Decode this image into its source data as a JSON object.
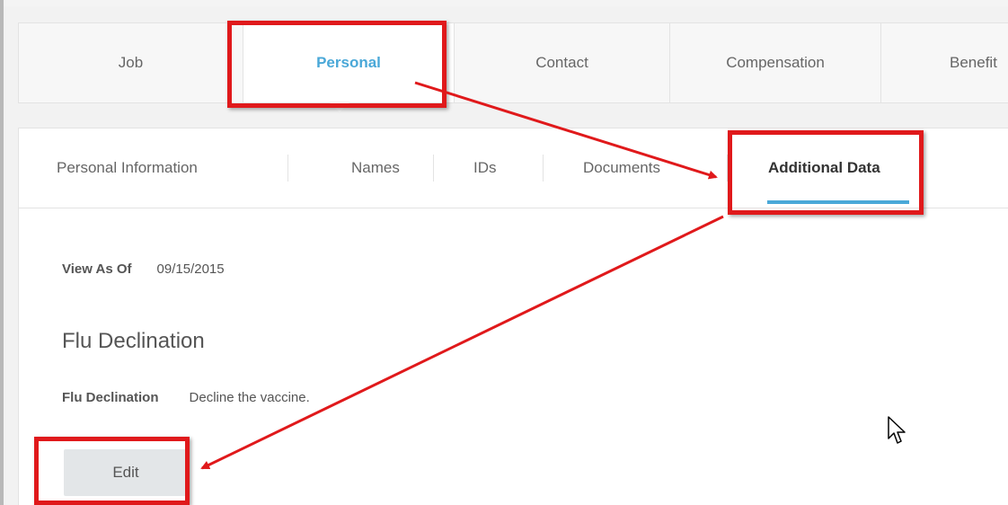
{
  "main_tabs": [
    {
      "label": "Job",
      "active": false
    },
    {
      "label": "Personal",
      "active": true
    },
    {
      "label": "Contact",
      "active": false
    },
    {
      "label": "Compensation",
      "active": false
    },
    {
      "label": "Benefit",
      "active": false
    }
  ],
  "sub_tabs": [
    {
      "label": "Personal Information",
      "active": false
    },
    {
      "label": "Names",
      "active": false
    },
    {
      "label": "IDs",
      "active": false
    },
    {
      "label": "Documents",
      "active": false
    },
    {
      "label": "Additional Data",
      "active": true
    }
  ],
  "view_as_of": {
    "label": "View As Of",
    "value": "09/15/2015"
  },
  "section": {
    "title": "Flu Declination"
  },
  "field": {
    "label": "Flu Declination",
    "value": "Decline the vaccine."
  },
  "edit_button": {
    "label": "Edit"
  },
  "colors": {
    "accent": "#4aa8d8",
    "annotation": "#e0191b",
    "button": "#e3e6e8"
  },
  "icons": {
    "cursor": "mouse-pointer-icon"
  }
}
